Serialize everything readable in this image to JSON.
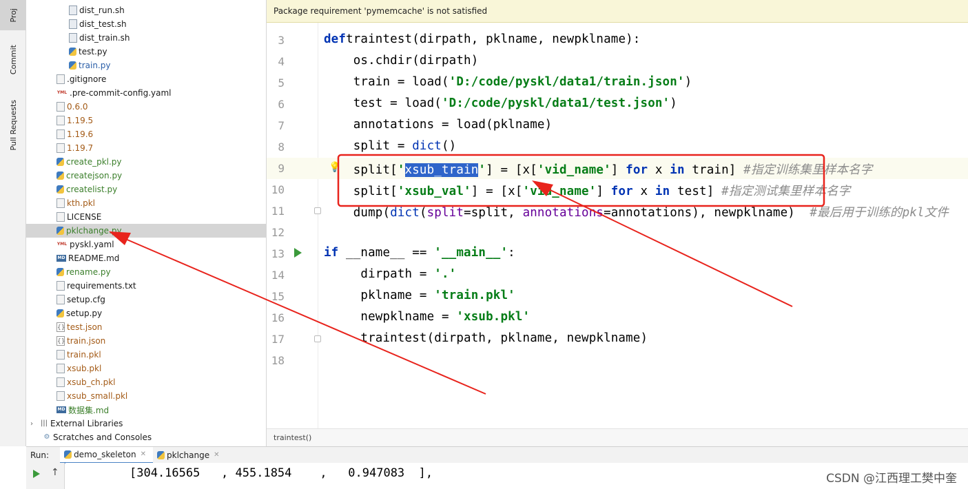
{
  "sidebar": {
    "tabs": [
      "Proj",
      "Commit",
      "Pull Requests"
    ]
  },
  "tree": {
    "items": [
      {
        "label": "dist_run.sh",
        "icon": "shell-file-icon",
        "kind": "sh",
        "color": "dark",
        "indent": 3
      },
      {
        "label": "dist_test.sh",
        "icon": "shell-file-icon",
        "kind": "sh",
        "color": "dark",
        "indent": 3
      },
      {
        "label": "dist_train.sh",
        "icon": "shell-file-icon",
        "kind": "sh",
        "color": "dark",
        "indent": 3
      },
      {
        "label": "test.py",
        "icon": "python-file-icon",
        "kind": "py",
        "color": "dark",
        "indent": 3
      },
      {
        "label": "train.py",
        "icon": "python-file-icon",
        "kind": "py",
        "color": "blue",
        "indent": 3
      },
      {
        "label": ".gitignore",
        "icon": "text-file-icon",
        "kind": "txt",
        "color": "dark",
        "indent": 2
      },
      {
        "label": ".pre-commit-config.yaml",
        "icon": "yaml-file-icon",
        "kind": "yml",
        "color": "dark",
        "indent": 2
      },
      {
        "label": "0.6.0",
        "icon": "text-file-icon",
        "kind": "txt",
        "color": "brown",
        "indent": 2
      },
      {
        "label": "1.19.5",
        "icon": "text-file-icon",
        "kind": "txt",
        "color": "brown",
        "indent": 2
      },
      {
        "label": "1.19.6",
        "icon": "text-file-icon",
        "kind": "txt",
        "color": "brown",
        "indent": 2
      },
      {
        "label": "1.19.7",
        "icon": "text-file-icon",
        "kind": "txt",
        "color": "brown",
        "indent": 2
      },
      {
        "label": "create_pkl.py",
        "icon": "python-file-icon",
        "kind": "py",
        "color": "green",
        "indent": 2
      },
      {
        "label": "createjson.py",
        "icon": "python-file-icon",
        "kind": "py",
        "color": "green",
        "indent": 2
      },
      {
        "label": "createlist.py",
        "icon": "python-file-icon",
        "kind": "py",
        "color": "green",
        "indent": 2
      },
      {
        "label": "kth.pkl",
        "icon": "text-file-icon",
        "kind": "txt",
        "color": "brown",
        "indent": 2
      },
      {
        "label": "LICENSE",
        "icon": "text-file-icon",
        "kind": "txt",
        "color": "dark",
        "indent": 2
      },
      {
        "label": "pklchange.py",
        "icon": "python-file-icon",
        "kind": "py",
        "color": "green",
        "indent": 2,
        "selected": true
      },
      {
        "label": "pyskl.yaml",
        "icon": "yaml-file-icon",
        "kind": "yml",
        "color": "dark",
        "indent": 2
      },
      {
        "label": "README.md",
        "icon": "markdown-file-icon",
        "kind": "md",
        "color": "dark",
        "indent": 2
      },
      {
        "label": "rename.py",
        "icon": "python-file-icon",
        "kind": "py",
        "color": "green",
        "indent": 2
      },
      {
        "label": "requirements.txt",
        "icon": "text-file-icon",
        "kind": "txt",
        "color": "dark",
        "indent": 2
      },
      {
        "label": "setup.cfg",
        "icon": "text-file-icon",
        "kind": "txt",
        "color": "dark",
        "indent": 2
      },
      {
        "label": "setup.py",
        "icon": "python-file-icon",
        "kind": "py",
        "color": "dark",
        "indent": 2
      },
      {
        "label": "test.json",
        "icon": "json-file-icon",
        "kind": "json",
        "color": "brown",
        "indent": 2
      },
      {
        "label": "train.json",
        "icon": "json-file-icon",
        "kind": "json",
        "color": "brown",
        "indent": 2
      },
      {
        "label": "train.pkl",
        "icon": "text-file-icon",
        "kind": "txt",
        "color": "brown",
        "indent": 2
      },
      {
        "label": "xsub.pkl",
        "icon": "text-file-icon",
        "kind": "txt",
        "color": "brown",
        "indent": 2
      },
      {
        "label": "xsub_ch.pkl",
        "icon": "text-file-icon",
        "kind": "txt",
        "color": "brown",
        "indent": 2
      },
      {
        "label": "xsub_small.pkl",
        "icon": "text-file-icon",
        "kind": "txt",
        "color": "brown",
        "indent": 2
      },
      {
        "label": "数据集.md",
        "icon": "markdown-file-icon",
        "kind": "md",
        "color": "green",
        "indent": 2
      },
      {
        "label": "External Libraries",
        "icon": "library-icon",
        "kind": "lib",
        "color": "dark",
        "indent": 0,
        "expander": true
      },
      {
        "label": "Scratches and Consoles",
        "icon": "scratch-icon",
        "kind": "scratch",
        "color": "dark",
        "indent": 1
      }
    ]
  },
  "editor": {
    "warning": "Package requirement 'pymemcache' is not satisfied",
    "breadcrumb": "traintest()",
    "lines": [
      {
        "n": "3",
        "tokens": [
          [
            "kw",
            "def"
          ],
          [
            "",
            "traintest(dirpath, pklname, newpklname):"
          ]
        ]
      },
      {
        "n": "4",
        "tokens": [
          [
            "",
            "    os.chdir(dirpath)"
          ]
        ]
      },
      {
        "n": "5",
        "tokens": [
          [
            "",
            "    train = load("
          ],
          [
            "str",
            "'D:/code/pyskl/data1/train.json'"
          ],
          [
            "",
            ")"
          ]
        ]
      },
      {
        "n": "6",
        "tokens": [
          [
            "",
            "    test = load("
          ],
          [
            "str",
            "'D:/code/pyskl/data1/test.json'"
          ],
          [
            "",
            ")"
          ]
        ]
      },
      {
        "n": "7",
        "tokens": [
          [
            "",
            "    annotations = load(pklname)"
          ]
        ]
      },
      {
        "n": "8",
        "tokens": [
          [
            "",
            "    split = "
          ],
          [
            "bi",
            "dict"
          ],
          [
            "",
            "()"
          ]
        ]
      },
      {
        "n": "9",
        "tokens": [
          [
            "",
            "    split["
          ],
          [
            "str",
            "'"
          ],
          [
            "sel",
            "xsub_train"
          ],
          [
            "str",
            "'"
          ],
          [
            "",
            "] = [x["
          ],
          [
            "str",
            "'vid_name'"
          ],
          [
            "",
            "] "
          ],
          [
            "kw",
            "for"
          ],
          [
            "",
            " x "
          ],
          [
            "kw",
            "in"
          ],
          [
            "",
            " train] "
          ],
          [
            "cmt",
            "#指定训练集里样本名字"
          ]
        ],
        "highlight": true,
        "bulb": true
      },
      {
        "n": "10",
        "tokens": [
          [
            "",
            "    split["
          ],
          [
            "str",
            "'xsub_val'"
          ],
          [
            "",
            "] = [x["
          ],
          [
            "str",
            "'vid_name'"
          ],
          [
            "",
            "] "
          ],
          [
            "kw",
            "for"
          ],
          [
            "",
            " x "
          ],
          [
            "kw",
            "in"
          ],
          [
            "",
            " test] "
          ],
          [
            "cmt",
            "#指定测试集里样本名字"
          ]
        ]
      },
      {
        "n": "11",
        "tokens": [
          [
            "",
            "    dump("
          ],
          [
            "bi",
            "dict"
          ],
          [
            "",
            "("
          ],
          [
            "param",
            "split"
          ],
          [
            "",
            "=split, "
          ],
          [
            "param",
            "annotations"
          ],
          [
            "",
            "=annotations), newpklname)  "
          ],
          [
            "cmt",
            "#最后用于训练的pkl文件"
          ]
        ],
        "fold": true
      },
      {
        "n": "12",
        "tokens": [
          [
            "",
            ""
          ]
        ]
      },
      {
        "n": "13",
        "tokens": [
          [
            "kw",
            "if"
          ],
          [
            "",
            " __name__ == "
          ],
          [
            "str",
            "'__main__'"
          ],
          [
            "",
            ":"
          ]
        ],
        "run": true
      },
      {
        "n": "14",
        "tokens": [
          [
            "",
            "     dirpath = "
          ],
          [
            "str",
            "'.'"
          ]
        ]
      },
      {
        "n": "15",
        "tokens": [
          [
            "",
            "     pklname = "
          ],
          [
            "str",
            "'train.pkl'"
          ]
        ]
      },
      {
        "n": "16",
        "tokens": [
          [
            "",
            "     newpklname = "
          ],
          [
            "str",
            "'xsub.pkl'"
          ]
        ]
      },
      {
        "n": "17",
        "tokens": [
          [
            "",
            "     traintest(dirpath, pklname, newpklname)"
          ]
        ],
        "fold": true
      },
      {
        "n": "18",
        "tokens": [
          [
            "",
            ""
          ]
        ]
      }
    ]
  },
  "run": {
    "label": "Run:",
    "tabs": [
      {
        "label": "demo_skeleton",
        "active": true
      },
      {
        "label": "pklchange",
        "active": false
      }
    ],
    "output": "[304.16565   , 455.1854    ,   0.947083  ],"
  },
  "watermark": "CSDN @江西理工樊中奎",
  "colors": {
    "annotation_red": "#e8231c",
    "keyword": "#0033b3",
    "string": "#067d17",
    "comment": "#8c8c8c",
    "selection": "#2f65ca"
  }
}
